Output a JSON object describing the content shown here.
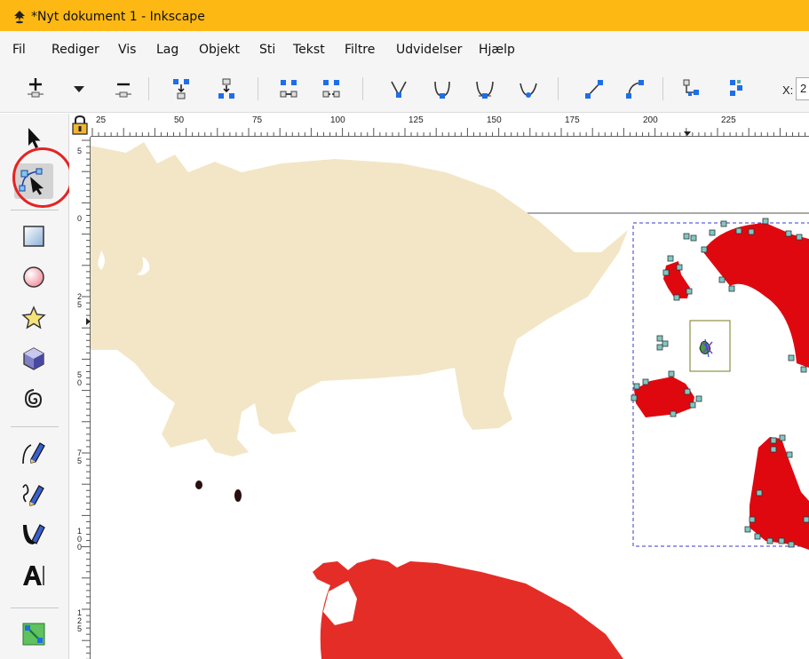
{
  "window": {
    "title": "*Nyt dokument 1 - Inkscape"
  },
  "menubar": {
    "items": [
      "Fil",
      "Rediger",
      "Vis",
      "Lag",
      "Objekt",
      "Sti",
      "Tekst",
      "Filtre",
      "Udvidelser",
      "Hjælp"
    ]
  },
  "toolbar": {
    "x_label": "X:",
    "x_value": "2"
  },
  "toolbox": {
    "tools": [
      "selector-tool",
      "node-tool",
      "rectangle-tool",
      "ellipse-tool",
      "star-tool",
      "3d-box-tool",
      "spiral-tool",
      "pen-tool",
      "pencil-tool",
      "calligraphy-tool",
      "text-tool",
      "connector-tool"
    ],
    "active_tool": "node-tool"
  },
  "rulers": {
    "horizontal_labels": [
      "25",
      "50",
      "75",
      "100",
      "125",
      "150",
      "175",
      "200",
      "225"
    ],
    "vertical_labels": [
      "5",
      "0",
      "2\n5",
      "5\n0",
      "7\n5",
      "1\n0\n0",
      "1\n2\n5"
    ]
  },
  "colors": {
    "titlebar": "#fdb813",
    "beige_dino": "#f3e6c6",
    "red_shapes": "#e0080f",
    "red_dino": "#e52d27",
    "node_handle": "#7ec8c4",
    "highlight_circle": "#e42323"
  }
}
